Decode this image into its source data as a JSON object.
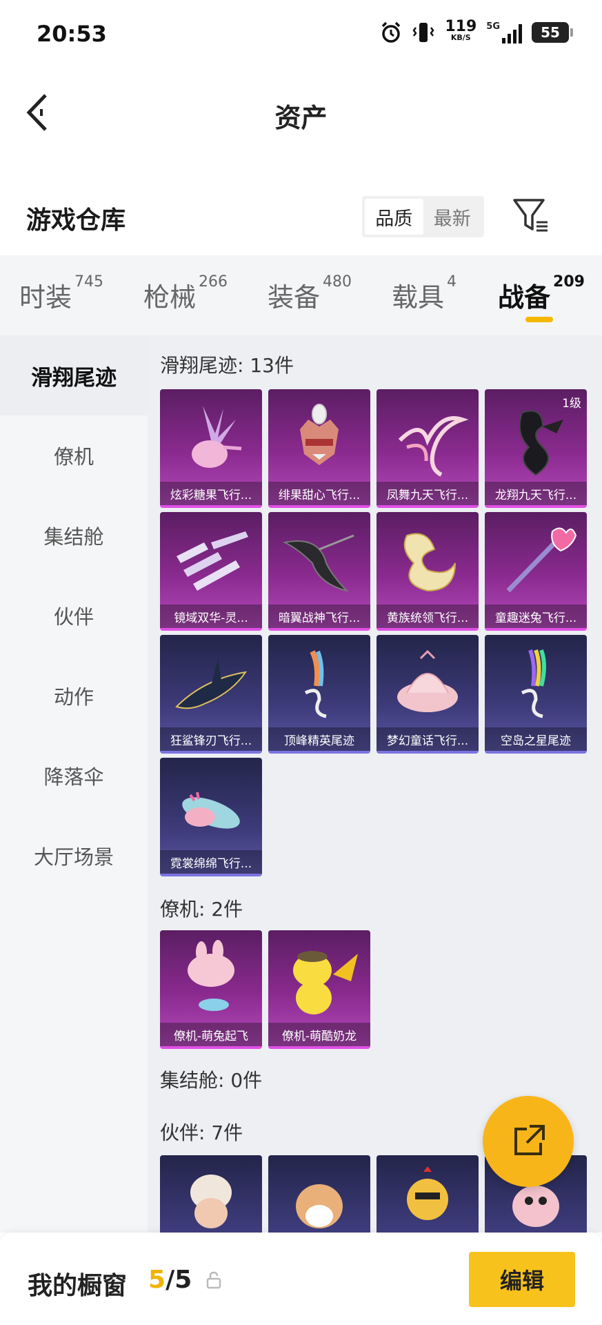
{
  "status_bar": {
    "time": "20:53",
    "speed_value": "119",
    "speed_unit": "KB/S",
    "network": "5G",
    "battery": "55"
  },
  "nav": {
    "title": "资产"
  },
  "warehouse": {
    "title": "游戏仓库",
    "sort_options": [
      "品质",
      "最新"
    ],
    "sort_selected": "品质"
  },
  "tabs": [
    {
      "label": "时装",
      "count": "745"
    },
    {
      "label": "枪械",
      "count": "266"
    },
    {
      "label": "装备",
      "count": "480"
    },
    {
      "label": "载具",
      "count": "4"
    },
    {
      "label": "战备",
      "count": "209",
      "active": true
    }
  ],
  "sidebar": {
    "items": [
      "滑翔尾迹",
      "僚机",
      "集结舱",
      "伙伴",
      "动作",
      "降落伞",
      "大厅场景"
    ],
    "active": "滑翔尾迹"
  },
  "sections": {
    "glide_trails": {
      "title": "滑翔尾迹: 13件",
      "items": [
        {
          "label": "炫彩糖果飞行...",
          "rarity": "purple",
          "icon": "candy-bouquet-icon"
        },
        {
          "label": "绯果甜心飞行...",
          "rarity": "purple",
          "icon": "fox-mask-icon"
        },
        {
          "label": "凤舞九天飞行...",
          "rarity": "purple",
          "icon": "phoenix-wings-icon"
        },
        {
          "label": "龙翔九天飞行...",
          "rarity": "purple",
          "icon": "black-dragon-icon",
          "badge": "1级"
        },
        {
          "label": "镜域双华-灵...",
          "rarity": "purple",
          "icon": "crystal-shards-icon"
        },
        {
          "label": "暗翼战神飞行...",
          "rarity": "purple",
          "icon": "dark-wings-icon"
        },
        {
          "label": "黄族统领飞行...",
          "rarity": "purple",
          "icon": "golden-dragon-icon"
        },
        {
          "label": "童趣迷兔飞行...",
          "rarity": "purple",
          "icon": "magic-wand-icon"
        },
        {
          "label": "狂鲨锋刃飞行...",
          "rarity": "blue",
          "icon": "shark-glider-icon"
        },
        {
          "label": "顶峰精英尾迹",
          "rarity": "blue",
          "icon": "smoke-trail-icon"
        },
        {
          "label": "梦幻童话飞行...",
          "rarity": "blue",
          "icon": "fairy-bed-icon"
        },
        {
          "label": "空岛之星尾迹",
          "rarity": "blue",
          "icon": "rainbow-trail-icon"
        },
        {
          "label": "霓裳绵绵飞行...",
          "rarity": "blue",
          "icon": "cute-plane-icon"
        }
      ]
    },
    "wingman": {
      "title": "僚机: 2件",
      "items": [
        {
          "label": "僚机-萌兔起飞",
          "rarity": "purple",
          "icon": "bunny-drone-icon"
        },
        {
          "label": "僚机-萌酷奶龙",
          "rarity": "purple",
          "icon": "yellow-dragon-icon"
        }
      ]
    },
    "pod": {
      "title": "集结舱: 0件"
    },
    "partner": {
      "title": "伙伴: 7件",
      "items": [
        {
          "rarity": "blue",
          "icon": "granny-figure-icon"
        },
        {
          "rarity": "blue",
          "icon": "shiba-dog-icon"
        },
        {
          "rarity": "blue",
          "icon": "chicken-figure-icon"
        },
        {
          "rarity": "blue",
          "icon": "pink-creature-icon"
        }
      ]
    }
  },
  "bottom": {
    "title": "我的橱窗",
    "current": "5",
    "separator": "/",
    "total": "5",
    "edit_label": "编辑"
  },
  "colors": {
    "accent": "#f5b800",
    "purple_rarity": "#8a2a8f",
    "blue_rarity": "#3c3a78"
  }
}
